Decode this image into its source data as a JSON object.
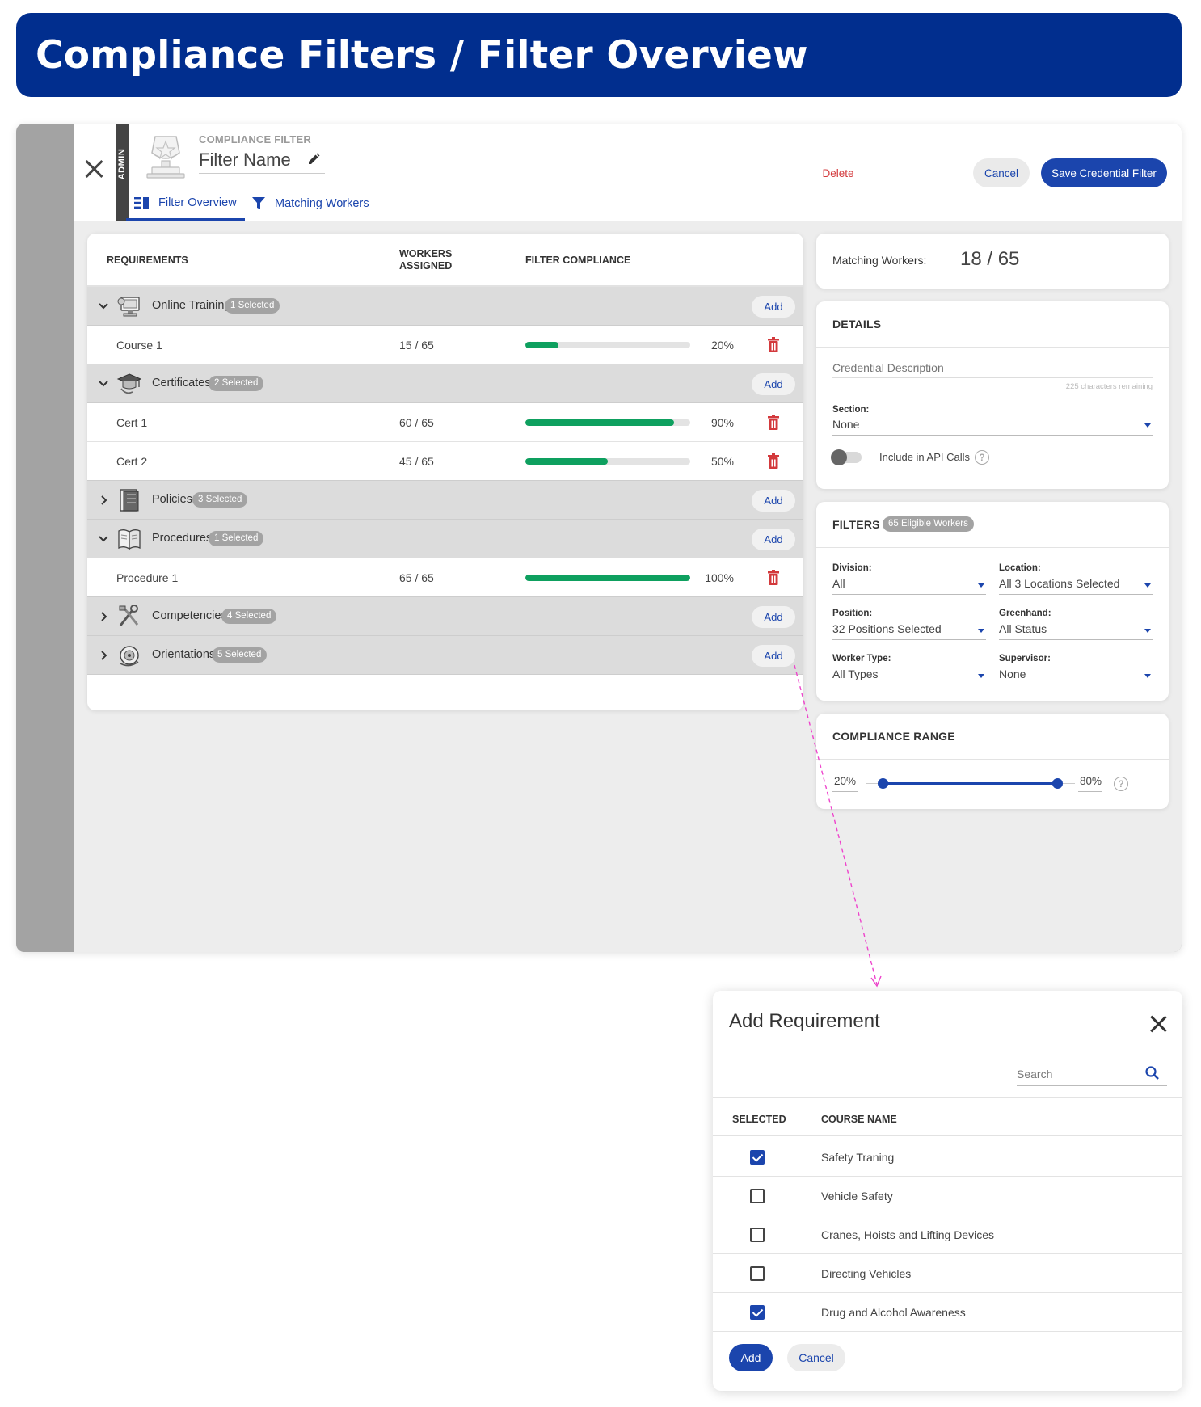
{
  "banner": {
    "title": "Compliance Filters / Filter Overview"
  },
  "header": {
    "admin_label": "ADMIN",
    "eyebrow": "COMPLIANCE FILTER",
    "filter_name": "Filter Name",
    "tabs": [
      "Filter Overview",
      "Matching Workers"
    ],
    "delete_label": "Delete",
    "cancel_label": "Cancel",
    "save_label": "Save Credential Filter"
  },
  "requirements": {
    "columns": [
      "REQUIREMENTS",
      "WORKERS ASSIGNED",
      "FILTER COMPLIANCE"
    ],
    "add_label": "Add",
    "groups": [
      {
        "name": "Online Training",
        "badge": "1 Selected",
        "expanded": true,
        "icon": "computer-icon",
        "items": [
          {
            "name": "Course 1",
            "assigned": "15 / 65",
            "compliance": 20,
            "pct": "20%"
          }
        ]
      },
      {
        "name": "Certificates",
        "badge": "2 Selected",
        "expanded": true,
        "icon": "graduation-cap-icon",
        "items": [
          {
            "name": "Cert 1",
            "assigned": "60 / 65",
            "compliance": 90,
            "pct": "90%"
          },
          {
            "name": "Cert 2",
            "assigned": "45 / 65",
            "compliance": 50,
            "pct": "50%"
          }
        ]
      },
      {
        "name": "Policies",
        "badge": "3 Selected",
        "expanded": false,
        "icon": "binder-icon",
        "items": []
      },
      {
        "name": "Procedures",
        "badge": "1 Selected",
        "expanded": true,
        "icon": "open-book-icon",
        "items": [
          {
            "name": "Procedure 1",
            "assigned": "65 / 65",
            "compliance": 100,
            "pct": "100%"
          }
        ]
      },
      {
        "name": "Competencies",
        "badge": "4 Selected",
        "expanded": false,
        "icon": "tools-icon",
        "items": []
      },
      {
        "name": "Orientations",
        "badge": "5 Selected",
        "expanded": false,
        "icon": "orientation-icon",
        "items": []
      }
    ]
  },
  "matching": {
    "label": "Matching Workers:",
    "value": "18 / 65"
  },
  "details": {
    "title": "DETAILS",
    "description_placeholder": "Credential Description",
    "chars_remaining": "225 characters remaining",
    "section_label": "Section:",
    "section_value": "None",
    "api_label": "Include in API Calls",
    "api_enabled": false
  },
  "filters": {
    "title": "FILTERS",
    "badge": "65 Eligible Workers",
    "fields": [
      {
        "label": "Division:",
        "value": "All"
      },
      {
        "label": "Location:",
        "value": "All 3 Locations Selected"
      },
      {
        "label": "Position:",
        "value": "32 Positions Selected"
      },
      {
        "label": "Greenhand:",
        "value": "All Status"
      },
      {
        "label": "Worker Type:",
        "value": "All Types"
      },
      {
        "label": "Supervisor:",
        "value": "None"
      }
    ]
  },
  "range": {
    "title": "COMPLIANCE RANGE",
    "min_label": "20%",
    "max_label": "80%",
    "min": 0.2,
    "max": 0.8
  },
  "modal": {
    "title": "Add Requirement",
    "search_placeholder": "Search",
    "columns": [
      "SELECTED",
      "COURSE NAME"
    ],
    "rows": [
      {
        "name": "Safety Traning",
        "selected": true
      },
      {
        "name": "Vehicle Safety",
        "selected": false
      },
      {
        "name": "Cranes, Hoists and Lifting Devices",
        "selected": false
      },
      {
        "name": "Directing Vehicles",
        "selected": false
      },
      {
        "name": "Drug and Alcohol Awareness",
        "selected": true
      }
    ],
    "add_label": "Add",
    "cancel_label": "Cancel"
  },
  "colors": {
    "brand": "#012e8e",
    "accent": "#1b45ad",
    "progress": "#0ea05f",
    "danger": "#d3393c",
    "connector": "#ee44cc"
  }
}
